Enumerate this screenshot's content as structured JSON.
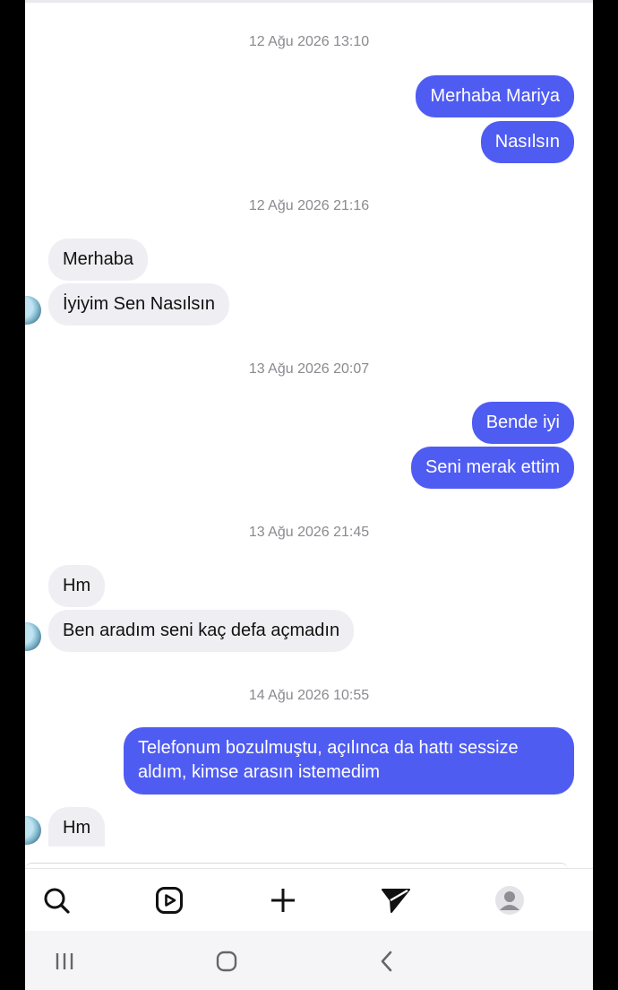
{
  "messages": {
    "ts1": "12 Ağu 2026 13:10",
    "m1": "Merhaba Mariya",
    "m2": "Nasılsın",
    "ts2": "12 Ağu 2026 21:16",
    "m3": "Merhaba",
    "m4": "İyiyim Sen Nasılsın",
    "ts3": "13 Ağu 2026 20:07",
    "m5": "Bende iyi",
    "m6": "Seni merak ettim",
    "ts4": "13 Ağu 2026 21:45",
    "m7": "Hm",
    "m8": "Ben aradım seni kaç defa açmadın",
    "ts5": "14 Ağu 2026 10:55",
    "m9": "Telefonum bozulmuştu, açılınca da hattı sessize aldım, kimse arasın istemedim",
    "m10": "Hm"
  },
  "tabbar": [
    "search-icon",
    "reels-icon",
    "create-icon",
    "direct-icon",
    "profile-icon"
  ],
  "navbar": [
    "recent-apps-icon",
    "home-icon",
    "back-icon"
  ],
  "colors": {
    "outgoing": "#4f5cf2",
    "incoming": "#efeff3"
  }
}
